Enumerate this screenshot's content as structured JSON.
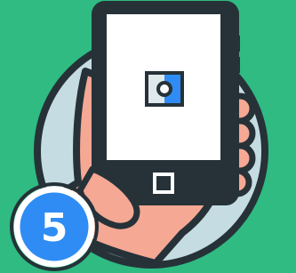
{
  "illustration": {
    "icon": "hand-holding-smartphone-icon",
    "screen_icon": "camera-app-icon",
    "home_button_icon": "home-button-icon"
  },
  "step_badge": {
    "label": "5"
  },
  "colors": {
    "background": "#2fbb82",
    "circle_fill": "#c5dde2",
    "outline": "#263238",
    "skin": "#f5a894",
    "phone_screen": "#ffffff",
    "badge": "#2f8cf4",
    "accent_blue": "#2f8cf4"
  }
}
